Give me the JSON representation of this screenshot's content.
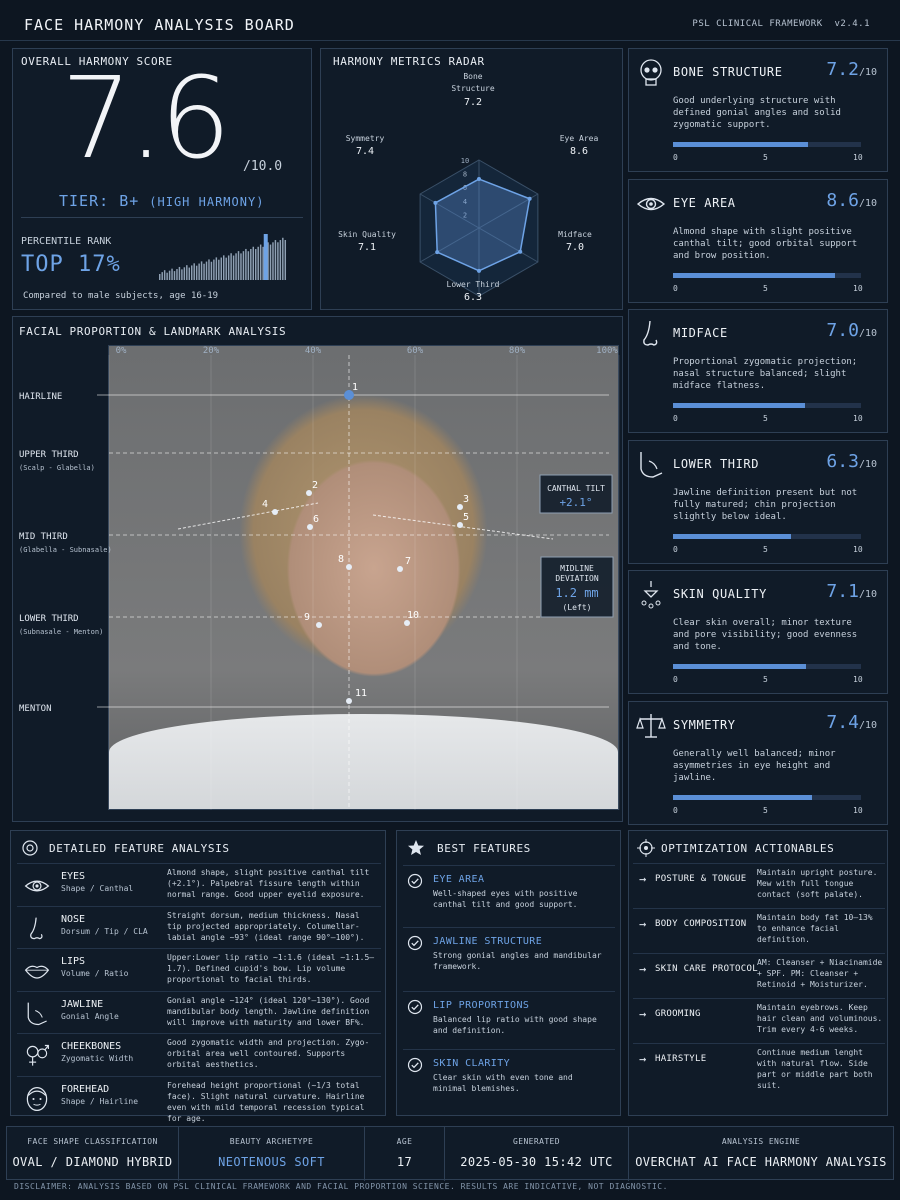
{
  "header": {
    "title": "FACE HARMONY ANALYSIS BOARD",
    "framework": "PSL CLINICAL FRAMEWORK",
    "version": "v2.4.1"
  },
  "score": {
    "title": "OVERALL HARMONY SCORE",
    "value": "7.6",
    "max": "/10.0",
    "tier_label": "TIER:",
    "tier": "B+",
    "tier_desc": "(HIGH HARMONY)",
    "percentile_label": "PERCENTILE RANK",
    "percentile": "TOP 17%",
    "percentile_fraction": 0.83,
    "note": "Compared to male subjects, age 16-19"
  },
  "radar": {
    "title": "HARMONY METRICS RADAR",
    "ticks": [
      "2",
      "4",
      "6",
      "8",
      "10"
    ],
    "axes": [
      {
        "label1": "Bone",
        "label2": "Structure",
        "value": "7.2",
        "v": 7.2
      },
      {
        "label1": "Eye Area",
        "label2": "",
        "value": "8.6",
        "v": 8.6
      },
      {
        "label1": "Midface",
        "label2": "",
        "value": "7.0",
        "v": 7.0
      },
      {
        "label1": "Lower Third",
        "label2": "",
        "value": "6.3",
        "v": 6.3
      },
      {
        "label1": "Skin Quality",
        "label2": "",
        "value": "7.1",
        "v": 7.1
      },
      {
        "label1": "Symmetry",
        "label2": "",
        "value": "7.4",
        "v": 7.4
      }
    ]
  },
  "proportion": {
    "title": "FACIAL PROPORTION & LANDMARK ANALYSIS",
    "xticks": [
      "0%",
      "20%",
      "40%",
      "60%",
      "80%",
      "100%"
    ],
    "zones": [
      {
        "name": "HAIRLINE",
        "sub": ""
      },
      {
        "name": "UPPER THIRD",
        "sub": "(Scalp - Glabella)"
      },
      {
        "name": "MID THIRD",
        "sub": "(Glabella - Subnasale)"
      },
      {
        "name": "LOWER THIRD",
        "sub": "(Subnasale - Menton)"
      },
      {
        "name": "MENTON",
        "sub": ""
      }
    ],
    "canthal_label": "CANTHAL TILT",
    "canthal_value": "+2.1°",
    "midline_label1": "MIDLINE",
    "midline_label2": "DEVIATION",
    "midline_value": "1.2 mm",
    "midline_side": "(Left)",
    "landmarks": [
      "1",
      "2",
      "3",
      "4",
      "5",
      "6",
      "7",
      "8",
      "9",
      "10",
      "11"
    ]
  },
  "metrics": [
    {
      "icon": "skull-icon",
      "title": "BONE STRUCTURE",
      "value": "7.2",
      "max": "/10",
      "fraction": 0.72,
      "desc": "Good underlying structure with defined gonial angles and solid zygomatic support.",
      "t0": "0",
      "t5": "5",
      "t10": "10"
    },
    {
      "icon": "eye-icon",
      "title": "EYE AREA",
      "value": "8.6",
      "max": "/10",
      "fraction": 0.86,
      "desc": "Almond shape with slight positive canthal tilt; good orbital support and brow position.",
      "t0": "0",
      "t5": "5",
      "t10": "10"
    },
    {
      "icon": "nose-icon",
      "title": "MIDFACE",
      "value": "7.0",
      "max": "/10",
      "fraction": 0.7,
      "desc": "Proportional zygomatic projection; nasal structure balanced; slight midface flatness.",
      "t0": "0",
      "t5": "5",
      "t10": "10"
    },
    {
      "icon": "jaw-icon",
      "title": "LOWER THIRD",
      "value": "6.3",
      "max": "/10",
      "fraction": 0.63,
      "desc": "Jawline definition present but not fully matured; chin projection slightly below ideal.",
      "t0": "0",
      "t5": "5",
      "t10": "10"
    },
    {
      "icon": "sparkle-icon",
      "title": "SKIN QUALITY",
      "value": "7.1",
      "max": "/10",
      "fraction": 0.71,
      "desc": "Clear skin overall; minor texture and pore visibility; good evenness and tone.",
      "t0": "0",
      "t5": "5",
      "t10": "10"
    },
    {
      "icon": "balance-icon",
      "title": "SYMMETRY",
      "value": "7.4",
      "max": "/10",
      "fraction": 0.74,
      "desc": "Generally well balanced; minor asymmetries in eye height and jawline.",
      "t0": "0",
      "t5": "5",
      "t10": "10"
    }
  ],
  "detailed": {
    "title": "DETAILED FEATURE ANALYSIS",
    "rows": [
      {
        "icon": "eye-icon",
        "name": "EYES",
        "sub": "Shape / Canthal",
        "desc": "Almond shape, slight positive canthal tilt (+2.1°). Palpebral fissure length within normal range. Good upper eyelid exposure."
      },
      {
        "icon": "nose-icon",
        "name": "NOSE",
        "sub": "Dorsum / Tip / CLA",
        "desc": "Straight dorsum, medium thickness. Nasal tip projected appropriately. Columellar-labial angle ~93° (ideal range 90°–100°)."
      },
      {
        "icon": "lips-icon",
        "name": "LIPS",
        "sub": "Volume / Ratio",
        "desc": "Upper:Lower lip ratio ~1:1.6 (ideal ~1:1.5–1.7). Defined cupid's bow. Lip volume proportional to facial thirds."
      },
      {
        "icon": "jaw-icon",
        "name": "JAWLINE",
        "sub": "Gonial Angle",
        "desc": "Gonial angle ~124° (ideal 120°–130°). Good mandibular body length. Jawline definition will improve with maturity and lower BF%."
      },
      {
        "icon": "gender-icon",
        "name": "CHEEKBONES",
        "sub": "Zygomatic Width",
        "desc": "Good zygomatic width and projection. Zygo-orbital area well contoured. Supports orbital aesthetics."
      },
      {
        "icon": "head-icon",
        "name": "FOREHEAD",
        "sub": "Shape / Hairline",
        "desc": "Forehead height proportional (~1/3 total face). Slight natural curvature. Hairline even with mild temporal recession typical for age."
      }
    ]
  },
  "best": {
    "title": "BEST FEATURES",
    "items": [
      {
        "title": "EYE AREA",
        "desc": "Well-shaped eyes with positive canthal tilt and good support."
      },
      {
        "title": "JAWLINE STRUCTURE",
        "desc": "Strong gonial angles and mandibular framework."
      },
      {
        "title": "LIP PROPORTIONS",
        "desc": "Balanced lip ratio with good shape and definition."
      },
      {
        "title": "SKIN CLARITY",
        "desc": "Clear skin with even tone and minimal blemishes."
      }
    ]
  },
  "optimization": {
    "title": "OPTIMIZATION ACTIONABLES",
    "rows": [
      {
        "title": "POSTURE & TONGUE",
        "desc": "Maintain upright posture. Mew with full tongue contact (soft palate)."
      },
      {
        "title": "BODY COMPOSITION",
        "desc": "Maintain body fat 10–13% to enhance facial definition."
      },
      {
        "title": "SKIN CARE PROTOCOL",
        "desc": "AM: Cleanser + Niacinamide + SPF. PM: Cleanser + Retinoid + Moisturizer."
      },
      {
        "title": "GROOMING",
        "desc": "Maintain eyebrows. Keep hair clean and voluminous. Trim every 4-6 weeks."
      },
      {
        "title": "HAIRSTYLE",
        "desc": "Continue medium lenght with natural flow. Side part or middle part both suit."
      }
    ]
  },
  "footer": {
    "shape_label": "FACE SHAPE CLASSIFICATION",
    "shape": "OVAL / DIAMOND HYBRID",
    "arch_label": "BEAUTY ARCHETYPE",
    "arch": "NEOTENOUS SOFT",
    "age_label": "AGE",
    "age": "17",
    "gen_label": "GENERATED",
    "gen": "2025-05-30 15:42 UTC",
    "engine_label": "ANALYSIS ENGINE",
    "engine": "OVERCHAT AI FACE HARMONY ANALYSIS"
  },
  "disclaimer": "DISCLAIMER: ANALYSIS BASED ON PSL CLINICAL FRAMEWORK AND FACIAL PROPORTION SCIENCE. RESULTS ARE INDICATIVE, NOT DIAGNOSTIC.",
  "colors": {
    "accent": "#6ea3e6",
    "bar": "#5b8fd6",
    "bg": "#0d1621",
    "panel": "#101b28",
    "border": "#2e3f54"
  }
}
